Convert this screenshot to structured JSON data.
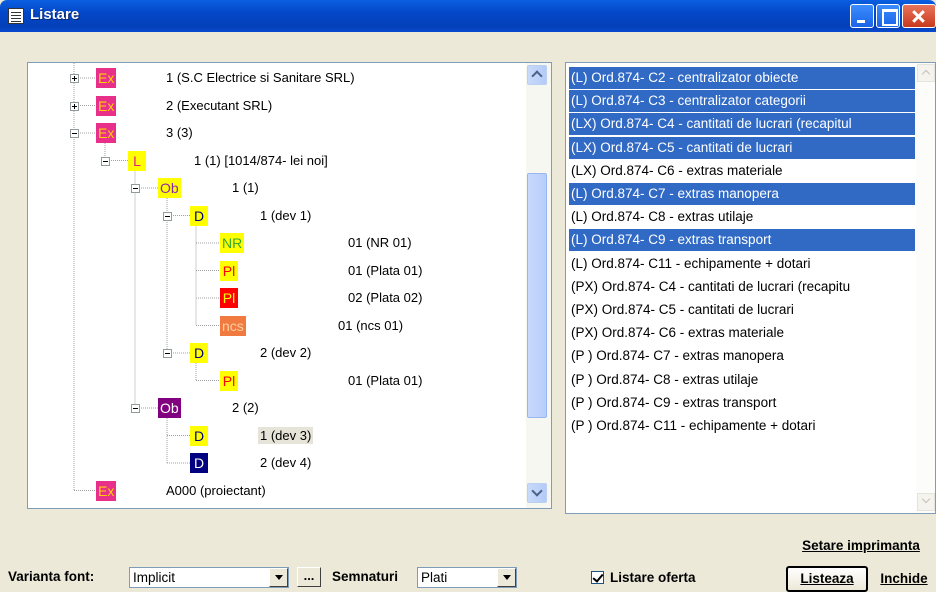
{
  "window": {
    "title": "Listare"
  },
  "tree": {
    "nodes": [
      {
        "type": "Ex",
        "label": "1 (S.C Electrice si Sanitare SRL)",
        "icon_color": "#e8308a",
        "icon_text_color": "#ffd200"
      },
      {
        "type": "Ex",
        "label": "2 (Executant SRL)",
        "icon_color": "#e8308a",
        "icon_text_color": "#ffd200"
      },
      {
        "type": "Ex",
        "label": "3 (3)",
        "icon_color": "#e8308a",
        "icon_text_color": "#ffd200"
      },
      {
        "type": "L",
        "label": "1 (1) [1014/874- lei noi]",
        "icon_color": "#ffff00",
        "icon_text_color": "#e0208a"
      },
      {
        "type": "Ob",
        "label": "1 (1)",
        "icon_color": "#ffff00",
        "icon_text_color": "#8b2aa8"
      },
      {
        "type": "D",
        "label": "1 (dev 1)",
        "icon_color": "#ffff00",
        "icon_text_color": "#000080"
      },
      {
        "type": "NR",
        "label": "01 (NR 01)",
        "icon_color": "#ffff00",
        "icon_text_color": "#33aa33"
      },
      {
        "type": "Pl",
        "label": "01 (Plata 01)",
        "icon_color": "#ffff00",
        "icon_text_color": "#ff0000"
      },
      {
        "type": "Pl",
        "label": "02 (Plata 02)",
        "icon_color": "#ff0000",
        "icon_text_color": "#ffff00"
      },
      {
        "type": "ncs",
        "label": "01 (ncs 01)",
        "icon_color": "#f07a40",
        "icon_text_color": "#ffd0a0"
      },
      {
        "type": "D",
        "label": "2 (dev 2)",
        "icon_color": "#ffff00",
        "icon_text_color": "#000080"
      },
      {
        "type": "Pl",
        "label": "01 (Plata 01)",
        "icon_color": "#ffff00",
        "icon_text_color": "#ff0000"
      },
      {
        "type": "Ob",
        "label": "2 (2)",
        "icon_color": "#800080",
        "icon_text_color": "#ffffff"
      },
      {
        "type": "D",
        "label": "1 (dev 3)",
        "icon_color": "#ffff00",
        "icon_text_color": "#000080",
        "selected": true
      },
      {
        "type": "D",
        "label": "2 (dev 4)",
        "icon_color": "#000080",
        "icon_text_color": "#ffffff"
      },
      {
        "type": "Ex",
        "label": "A000 (proiectant)",
        "icon_color": "#e8308a",
        "icon_text_color": "#ffd200"
      }
    ]
  },
  "reports": {
    "items": [
      {
        "label": "(L) Ord.874- C2 - centralizator obiecte",
        "selected": true
      },
      {
        "label": "(L) Ord.874- C3 - centralizator categorii",
        "selected": true
      },
      {
        "label": "(LX) Ord.874- C4 - cantitati de lucrari (recapitul",
        "selected": true
      },
      {
        "label": "(LX) Ord.874- C5 - cantitati de lucrari",
        "selected": true
      },
      {
        "label": "(LX) Ord.874- C6 - extras materiale",
        "selected": false
      },
      {
        "label": "(L) Ord.874- C7 - extras manopera",
        "selected": true
      },
      {
        "label": "(L) Ord.874- C8 - extras utilaje",
        "selected": false
      },
      {
        "label": "(L) Ord.874- C9 - extras transport",
        "selected": true
      },
      {
        "label": "(L) Ord.874- C11 - echipamente + dotari",
        "selected": false
      },
      {
        "label": "(PX) Ord.874- C4 - cantitati de lucrari (recapitu",
        "selected": false
      },
      {
        "label": "(PX) Ord.874- C5 - cantitati de lucrari",
        "selected": false
      },
      {
        "label": "(PX) Ord.874- C6 - extras materiale",
        "selected": false
      },
      {
        "label": "(P ) Ord.874- C7 - extras manopera",
        "selected": false
      },
      {
        "label": "(P ) Ord.874- C8 - extras utilaje",
        "selected": false
      },
      {
        "label": "(P ) Ord.874- C9 - extras transport",
        "selected": false
      },
      {
        "label": "(P ) Ord.874- C11 - echipamente + dotari",
        "selected": false
      }
    ]
  },
  "footer": {
    "font_variant_label": "Varianta font:",
    "font_variant_value": "Implicit",
    "browse_label": "...",
    "signatures_label": "Semnaturi",
    "signatures_value": "Plati",
    "list_offer_label": "Listare oferta",
    "list_offer_checked": true,
    "setup_printer_label": "Setare imprimanta",
    "list_label": "Listeaza",
    "close_label": "Inchide"
  }
}
